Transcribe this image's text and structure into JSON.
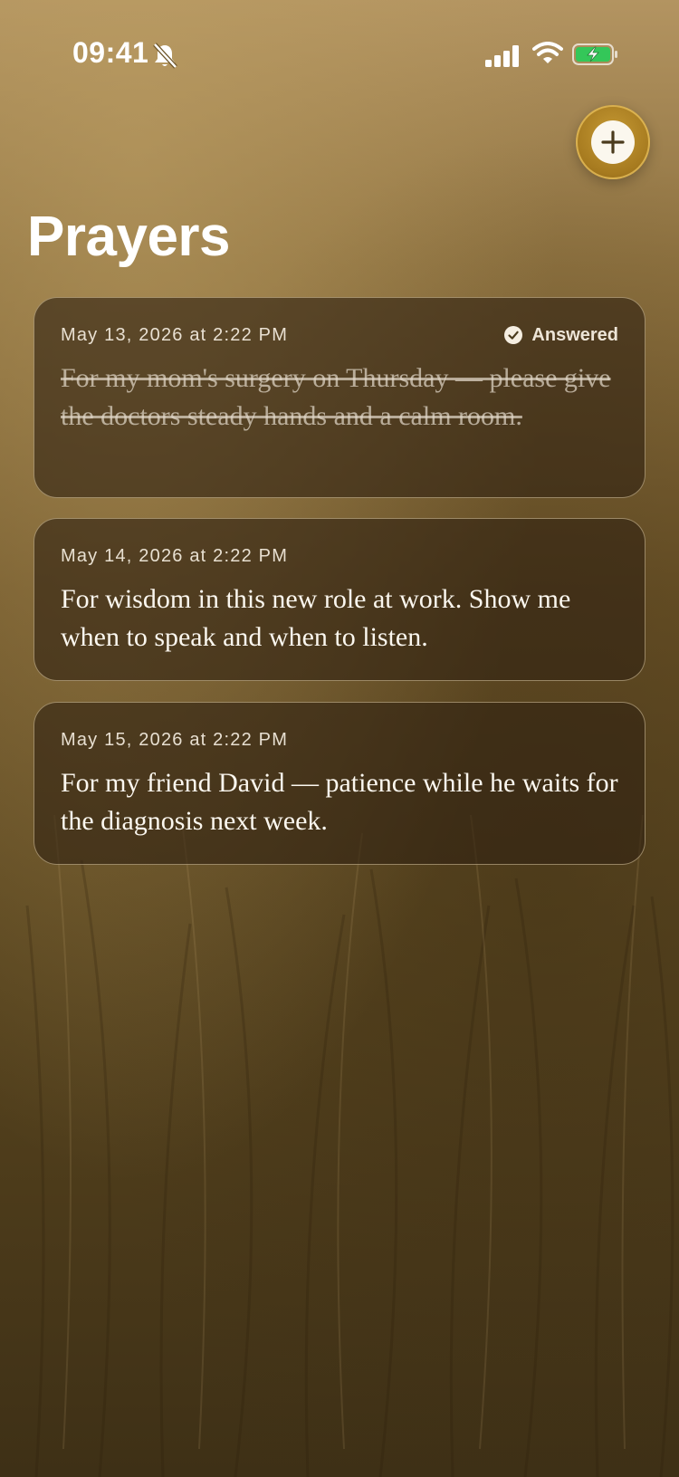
{
  "status_bar": {
    "time": "09:41"
  },
  "icons": {
    "silent": "bell-slash-icon",
    "signal": "cellular-signal-icon",
    "wifi": "wifi-icon",
    "battery": "battery-charging-icon",
    "add": "plus-icon",
    "answered": "checkmark-circle-icon"
  },
  "colors": {
    "accent": "#b8892a",
    "battery_fill": "#34c759"
  },
  "page": {
    "title": "Prayers"
  },
  "prayers": [
    {
      "date": "May 13, 2026 at 2:22 PM",
      "text": "For my mom's surgery on Thursday — please give the doctors steady hands and a calm room.",
      "status": "Answered"
    },
    {
      "date": "May 14, 2026 at 2:22 PM",
      "text": "For wisdom in this new role at work. Show me when to speak and when to listen."
    },
    {
      "date": "May 15, 2026 at 2:22 PM",
      "text": "For my friend David — patience while he waits for the diagnosis next week."
    }
  ]
}
